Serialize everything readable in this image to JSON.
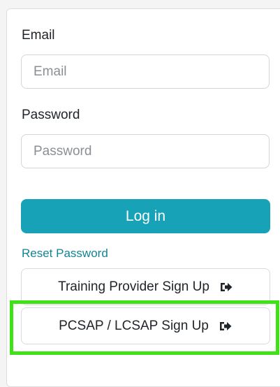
{
  "form": {
    "email_label": "Email",
    "email_placeholder": "Email",
    "password_label": "Password",
    "password_placeholder": "Password",
    "login_label": "Log in",
    "reset_label": "Reset Password",
    "training_signup_label": "Training Provider Sign Up",
    "pcsap_signup_label": "PCSAP / LCSAP Sign Up"
  },
  "colors": {
    "primary": "#17a2b8",
    "link": "#138496",
    "highlight": "#3ee216"
  },
  "icons": {
    "signup": "sign-in-arrow-icon"
  }
}
